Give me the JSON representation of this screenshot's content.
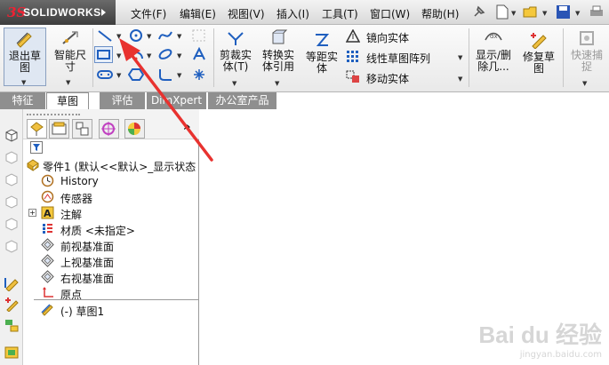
{
  "app": {
    "logo_ds": "3S",
    "logo_name": "SOLIDWORKS"
  },
  "menu": [
    "文件(F)",
    "编辑(E)",
    "视图(V)",
    "插入(I)",
    "工具(T)",
    "窗口(W)",
    "帮助(H)"
  ],
  "ribbon": {
    "exit_sketch": [
      "退出草",
      "图"
    ],
    "smart_dim": [
      "智能尺",
      "寸"
    ],
    "trim": [
      "剪裁实",
      "体(T)"
    ],
    "convert": [
      "转换实",
      "体引用"
    ],
    "offset": [
      "等距实",
      "体"
    ],
    "mirror": "镜向实体",
    "linear_pattern": "线性草图阵列",
    "move": "移动实体",
    "show_delete": [
      "显示/删",
      "除几..."
    ],
    "repair": [
      "修复草",
      "图"
    ],
    "quick_capture": [
      "快速捕",
      "捉"
    ]
  },
  "tabs": [
    "特征",
    "草图",
    "评估",
    "DimXpert",
    "办公室产品"
  ],
  "active_tab": "草图",
  "fm_more": "»",
  "tree": {
    "root": "零件1 (默认<<默认>_显示状态",
    "items": [
      "History",
      "传感器",
      "注解",
      "材质 <未指定>",
      "前视基准面",
      "上视基准面",
      "右视基准面",
      "原点"
    ],
    "sketch": "(-) 草图1"
  },
  "watermark": {
    "brand": "Bai du 经验",
    "url": "jingyan.baidu.com"
  },
  "colors": {
    "arrow": "#e8322f",
    "accent_blue": "#1f5fbf",
    "tab_grey": "#8f8f8f"
  }
}
